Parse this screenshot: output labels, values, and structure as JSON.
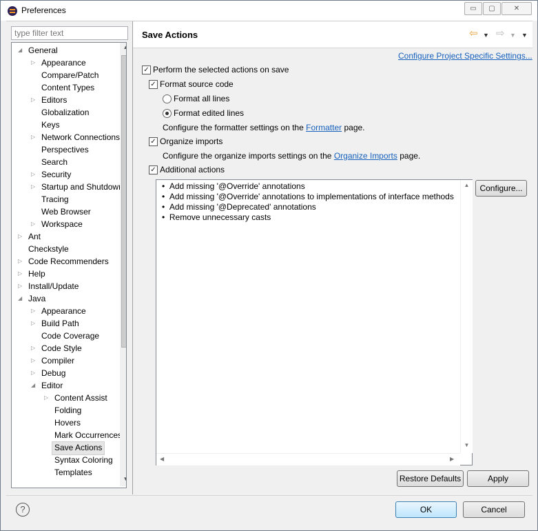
{
  "window": {
    "title": "Preferences",
    "minimize": "▭",
    "maximize": "▢",
    "close": "✕"
  },
  "filter": {
    "placeholder": "type filter text"
  },
  "tree": {
    "items": [
      {
        "label": "General",
        "arrow": "◢"
      },
      {
        "label": "Appearance",
        "arrow": "▷"
      },
      {
        "label": "Compare/Patch",
        "arrow": ""
      },
      {
        "label": "Content Types",
        "arrow": ""
      },
      {
        "label": "Editors",
        "arrow": "▷"
      },
      {
        "label": "Globalization",
        "arrow": ""
      },
      {
        "label": "Keys",
        "arrow": ""
      },
      {
        "label": "Network Connections",
        "arrow": "▷"
      },
      {
        "label": "Perspectives",
        "arrow": ""
      },
      {
        "label": "Search",
        "arrow": ""
      },
      {
        "label": "Security",
        "arrow": "▷"
      },
      {
        "label": "Startup and Shutdown",
        "arrow": "▷"
      },
      {
        "label": "Tracing",
        "arrow": ""
      },
      {
        "label": "Web Browser",
        "arrow": ""
      },
      {
        "label": "Workspace",
        "arrow": "▷"
      },
      {
        "label": "Ant",
        "arrow": "▷"
      },
      {
        "label": "Checkstyle",
        "arrow": ""
      },
      {
        "label": "Code Recommenders",
        "arrow": "▷"
      },
      {
        "label": "Help",
        "arrow": "▷"
      },
      {
        "label": "Install/Update",
        "arrow": "▷"
      },
      {
        "label": "Java",
        "arrow": "◢"
      },
      {
        "label": "Appearance",
        "arrow": "▷"
      },
      {
        "label": "Build Path",
        "arrow": "▷"
      },
      {
        "label": "Code Coverage",
        "arrow": ""
      },
      {
        "label": "Code Style",
        "arrow": "▷"
      },
      {
        "label": "Compiler",
        "arrow": "▷"
      },
      {
        "label": "Debug",
        "arrow": "▷"
      },
      {
        "label": "Editor",
        "arrow": "◢"
      },
      {
        "label": "Content Assist",
        "arrow": "▷"
      },
      {
        "label": "Folding",
        "arrow": ""
      },
      {
        "label": "Hovers",
        "arrow": ""
      },
      {
        "label": "Mark Occurrences",
        "arrow": ""
      },
      {
        "label": "Save Actions",
        "arrow": ""
      },
      {
        "label": "Syntax Coloring",
        "arrow": ""
      },
      {
        "label": "Templates",
        "arrow": ""
      }
    ]
  },
  "page": {
    "title": "Save Actions",
    "configure_link": "Configure Project Specific Settings...",
    "perform_label": "Perform the selected actions on save",
    "format_label": "Format source code",
    "format_all": "Format all lines",
    "format_edited": "Format edited lines",
    "formatter_pre": "Configure the formatter settings on the",
    "formatter_link": "Formatter",
    "formatter_post": "page.",
    "organize_label": "Organize imports",
    "organize_pre": "Configure the organize imports settings on the",
    "organize_link": "Organize Imports",
    "organize_post": "page.",
    "additional_label": "Additional actions",
    "actions": [
      "Add missing '@Override' annotations",
      "Add missing '@Override' annotations to implementations of interface methods",
      "Add missing '@Deprecated' annotations",
      "Remove unnecessary casts"
    ],
    "configure_button": "Configure...",
    "restore_button": "Restore Defaults",
    "apply_button": "Apply"
  },
  "footer": {
    "ok": "OK",
    "cancel": "Cancel",
    "help": "?"
  },
  "colors": {
    "link": "#1560bd",
    "nav_arrow": "#e8a23a"
  }
}
